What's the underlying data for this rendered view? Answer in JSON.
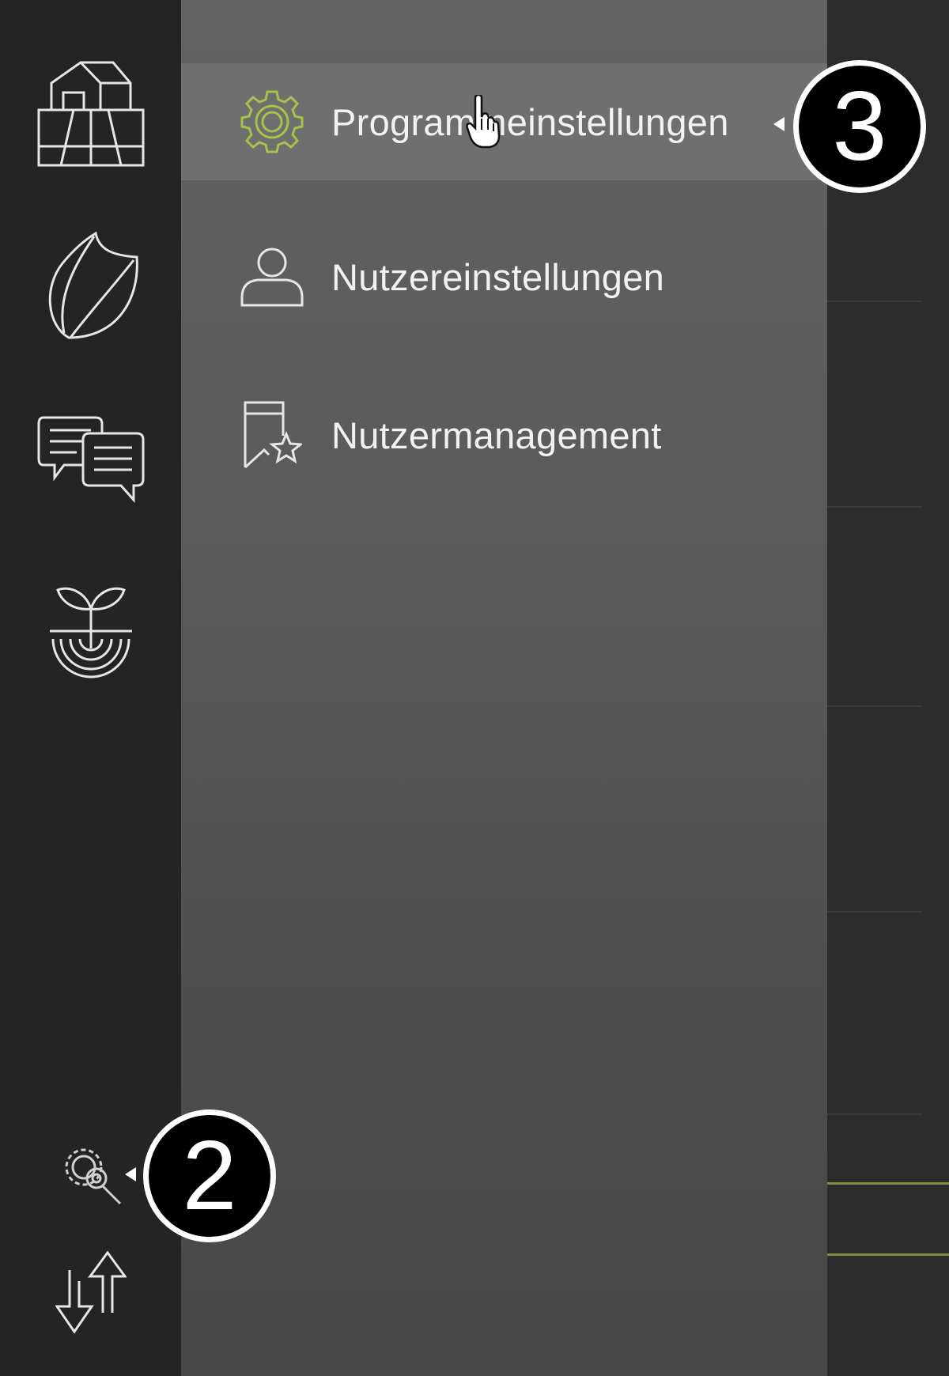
{
  "rail": {
    "items": [
      {
        "icon": "farm-icon"
      },
      {
        "icon": "leaf-icon"
      },
      {
        "icon": "chat-icon"
      },
      {
        "icon": "sprout-icon"
      },
      {
        "icon": "settings-gears-icon"
      },
      {
        "icon": "sync-arrows-icon"
      }
    ]
  },
  "settings_menu": {
    "items": [
      {
        "label": "Programmeinstellungen",
        "icon": "gear-icon",
        "active": true
      },
      {
        "label": "Nutzereinstellungen",
        "icon": "user-icon",
        "active": false
      },
      {
        "label": "Nutzermanagement",
        "icon": "bookmark-star-icon",
        "active": false
      }
    ]
  },
  "callouts": {
    "settings": "2",
    "program_settings": "3"
  },
  "colors": {
    "accent": "#a6c24a",
    "rail_bg": "#242424",
    "panel_bg": "#5b5b5b",
    "active_item_bg": "#6f6f6f"
  }
}
